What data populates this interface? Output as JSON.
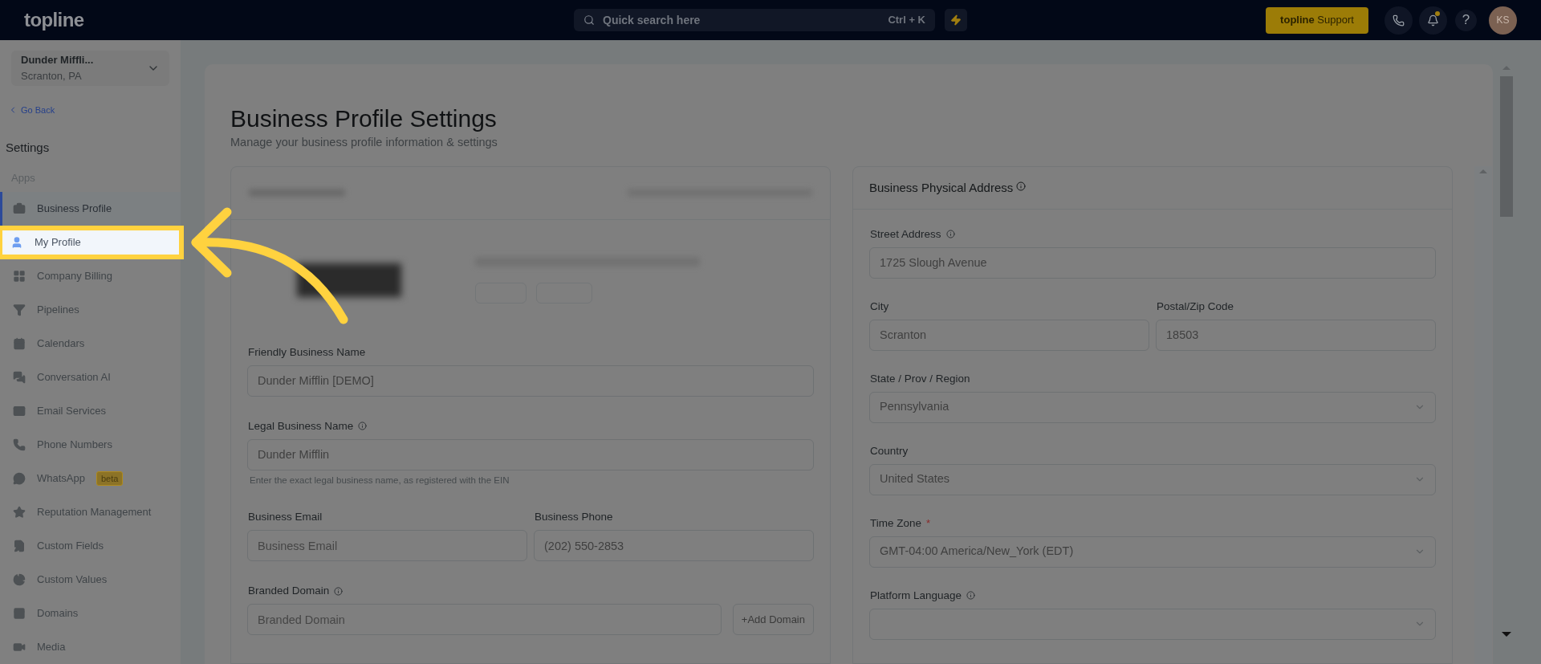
{
  "topbar": {
    "logo": "topline",
    "search": {
      "placeholder": "Quick search here",
      "shortcut": "Ctrl + K"
    },
    "support": {
      "brand": "topline",
      "label": "Support"
    },
    "help": "?",
    "avatar": "KS"
  },
  "sidebar": {
    "account": {
      "name": "Dunder Miffli...",
      "location": "Scranton, PA"
    },
    "back": "Go Back",
    "heading": "Settings",
    "section": "Apps",
    "items": [
      {
        "label": "Business Profile",
        "selected": true,
        "highlighted": false
      },
      {
        "label": "My Profile",
        "selected": false,
        "highlighted": true
      },
      {
        "label": "Company Billing",
        "selected": false,
        "highlighted": false
      },
      {
        "label": "Pipelines",
        "selected": false,
        "highlighted": false
      },
      {
        "label": "Calendars",
        "selected": false,
        "highlighted": false
      },
      {
        "label": "Conversation AI",
        "selected": false,
        "highlighted": false
      },
      {
        "label": "Email Services",
        "selected": false,
        "highlighted": false
      },
      {
        "label": "Phone Numbers",
        "selected": false,
        "highlighted": false
      },
      {
        "label": "WhatsApp",
        "selected": false,
        "highlighted": false,
        "badge": "beta"
      },
      {
        "label": "Reputation Management",
        "selected": false,
        "highlighted": false
      },
      {
        "label": "Custom Fields",
        "selected": false,
        "highlighted": false
      },
      {
        "label": "Custom Values",
        "selected": false,
        "highlighted": false
      },
      {
        "label": "Domains",
        "selected": false,
        "highlighted": false
      },
      {
        "label": "Media",
        "selected": false,
        "highlighted": false
      }
    ]
  },
  "page": {
    "title": "Business Profile Settings",
    "subtitle": "Manage your business profile information & settings"
  },
  "left_card": {
    "rows": [
      [
        {
          "kind": "input",
          "label": "Friendly Business Name",
          "value": "Dunder Mifflin [DEMO]",
          "info": false
        }
      ],
      [
        {
          "kind": "input",
          "label": "Legal Business Name",
          "value": "Dunder Mifflin",
          "info": true,
          "hint": "Enter the exact legal business name, as registered with the EIN"
        }
      ],
      [
        {
          "kind": "input",
          "label": "Business Email",
          "placeholder": "Business Email",
          "info": false
        },
        {
          "kind": "input",
          "label": "Business Phone",
          "value": "(202) 550-2853",
          "info": false
        }
      ],
      [
        {
          "kind": "input",
          "label": "Branded Domain",
          "placeholder": "Branded Domain",
          "info": true,
          "action": "+Add Domain"
        }
      ]
    ]
  },
  "right_card": {
    "title": "Business Physical Address",
    "info": true,
    "rows": [
      [
        {
          "kind": "input",
          "label": "Street Address",
          "value": "1725 Slough Avenue",
          "info": true
        }
      ],
      [
        {
          "kind": "input",
          "label": "City",
          "value": "Scranton",
          "info": false
        },
        {
          "kind": "input",
          "label": "Postal/Zip Code",
          "value": "18503",
          "info": false
        }
      ],
      [
        {
          "kind": "select",
          "label": "State / Prov / Region",
          "value": "Pennsylvania",
          "info": false
        }
      ],
      [
        {
          "kind": "select",
          "label": "Country",
          "value": "United States",
          "info": false
        }
      ],
      [
        {
          "kind": "select",
          "label": "Time Zone",
          "value": "GMT-04:00 America/New_York (EDT)",
          "info": false,
          "required_mark": "*"
        }
      ],
      [
        {
          "kind": "select",
          "label": "Platform Language",
          "info": true
        }
      ]
    ]
  }
}
